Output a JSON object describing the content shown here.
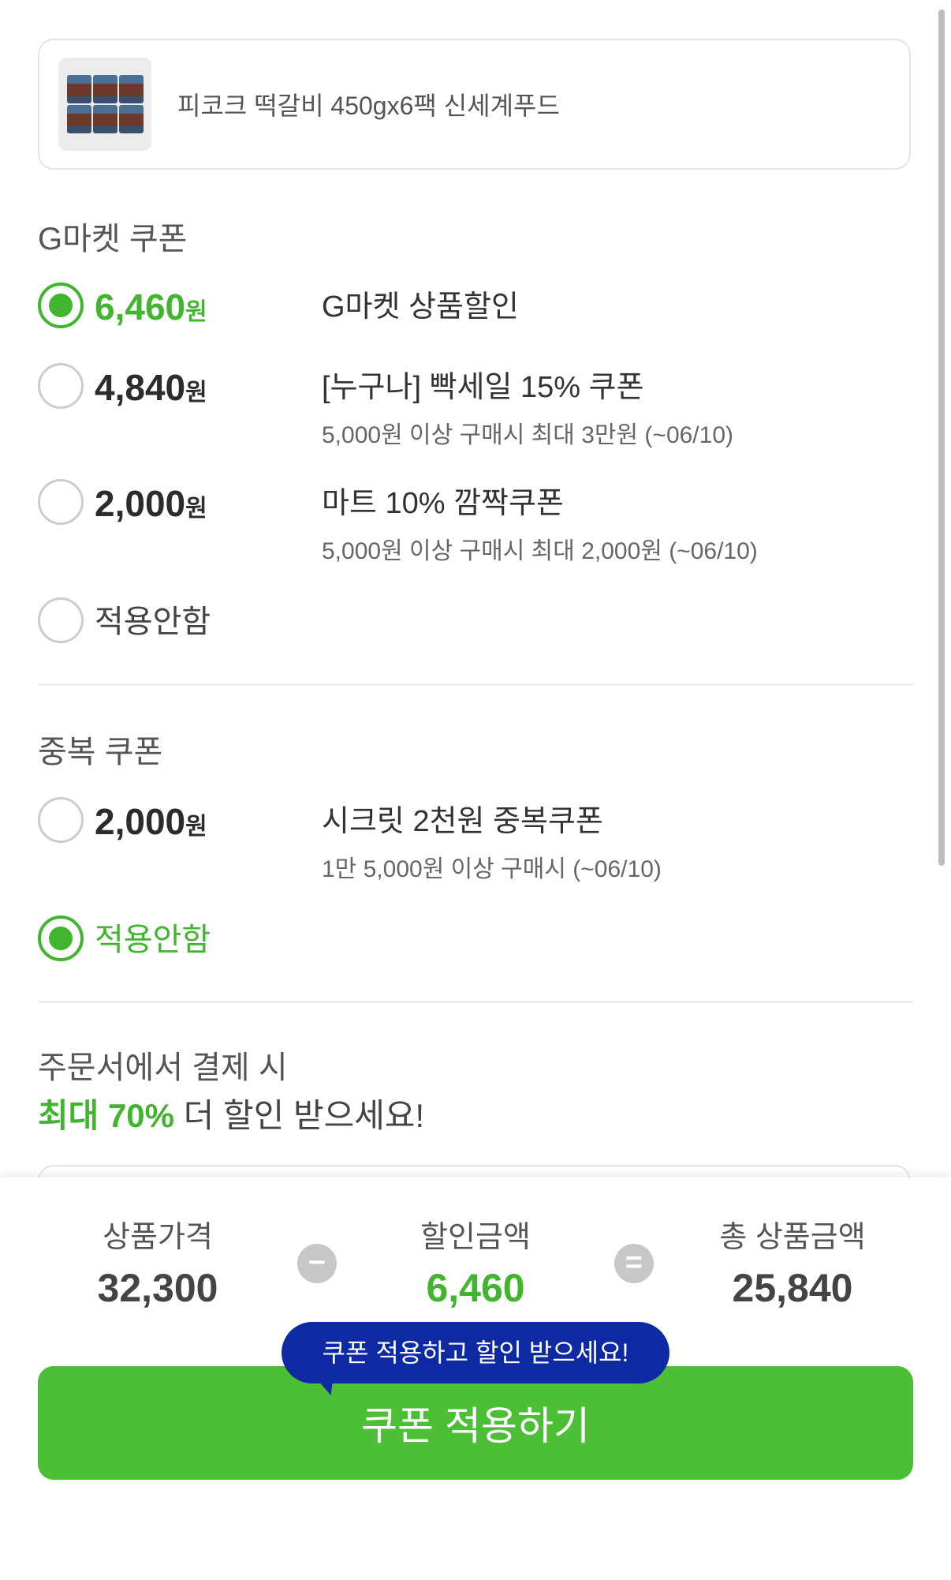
{
  "product": {
    "name": "피코크 떡갈비 450gx6팩 신세계푸드"
  },
  "gmarket_section": {
    "title": "G마켓 쿠폰",
    "options": [
      {
        "amount": "6,460",
        "unit": "원",
        "name": "G마켓 상품할인",
        "condition": "",
        "selected": true
      },
      {
        "amount": "4,840",
        "unit": "원",
        "name": "[누구나] 빡세일 15% 쿠폰",
        "condition": "5,000원 이상 구매시 최대 3만원 (~06/10)",
        "selected": false
      },
      {
        "amount": "2,000",
        "unit": "원",
        "name": "마트 10% 깜짝쿠폰",
        "condition": "5,000원 이상 구매시 최대 2,000원 (~06/10)",
        "selected": false
      }
    ],
    "none_label": "적용안함",
    "none_selected": false
  },
  "duplicate_section": {
    "title": "중복 쿠폰",
    "options": [
      {
        "amount": "2,000",
        "unit": "원",
        "name": "시크릿 2천원 중복쿠폰",
        "condition": "1만 5,000원 이상 구매시 (~06/10)",
        "selected": false
      }
    ],
    "none_label": "적용안함",
    "none_selected": true
  },
  "promo": {
    "line1": "주문서에서 결제 시",
    "highlight": "최대 70%",
    "line2_rest": " 더 할인 받으세요!"
  },
  "summary": {
    "price_label": "상품가격",
    "price_value": "32,300",
    "minus_symbol": "−",
    "discount_label": "할인금액",
    "discount_value": "6,460",
    "equals_symbol": "=",
    "total_label": "총 상품금액",
    "total_value": "25,840"
  },
  "tooltip": {
    "text": "쿠폰 적용하고 할인 받으세요!"
  },
  "apply_button": {
    "label": "쿠폰 적용하기"
  },
  "colors": {
    "accent": "#41b52d",
    "button": "#4cbf36",
    "tooltip": "#0d2aa3"
  }
}
